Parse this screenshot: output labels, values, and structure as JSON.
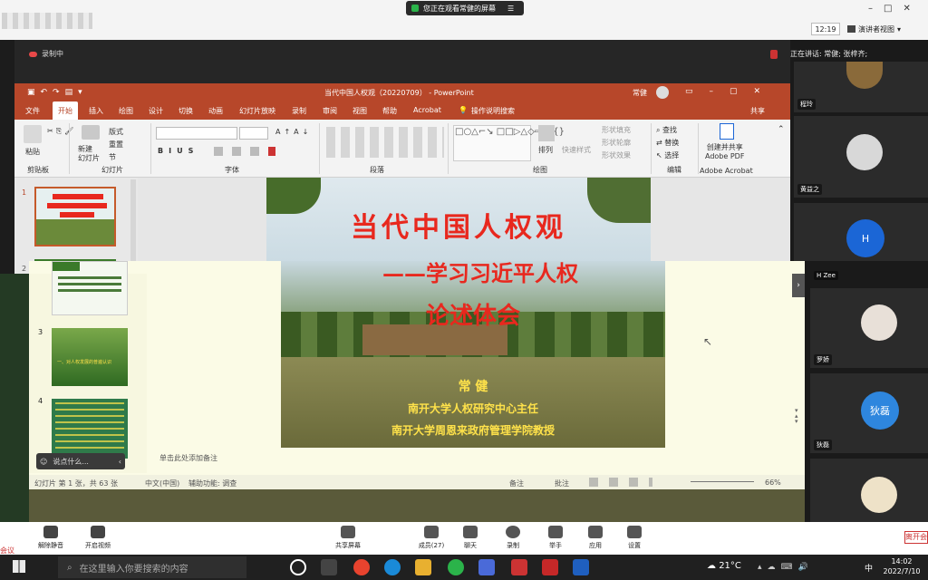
{
  "screen_share_banner": "您正在观看常健的屏幕",
  "clock": "12:19",
  "view_mode": "演讲者视图",
  "recording_label": "录制中",
  "speaking_text": "正在讲话: 常健; 张梓齐;",
  "participants_upper": [
    {
      "name": "程玲"
    },
    {
      "name": "黄益之"
    },
    {
      "name": "",
      "initial": "H"
    }
  ],
  "participants_lower": [
    {
      "name": "H Zee"
    },
    {
      "name": "罗娇"
    },
    {
      "name": "狄磊",
      "initial": "狄磊"
    },
    {
      "name": ""
    }
  ],
  "ppt": {
    "title": "当代中国人权观（20220709） - PowerPoint",
    "user": "常健",
    "tabs": [
      "文件",
      "开始",
      "插入",
      "绘图",
      "设计",
      "切换",
      "动画",
      "幻灯片放映",
      "录制",
      "审阅",
      "视图",
      "帮助",
      "Acrobat"
    ],
    "tell_me": "操作说明搜索",
    "share": "共享",
    "groups": {
      "clipboard": "剪贴板",
      "slides": "幻灯片",
      "font": "字体",
      "paragraph": "段落",
      "drawing": "绘图",
      "editing": "编辑",
      "acrobat": "Adobe Acrobat"
    },
    "buttons": {
      "paste": "粘贴",
      "new_slide": "新建\n幻灯片",
      "layout": "版式",
      "reset": "重置",
      "section": "节",
      "arrange": "排列",
      "quick_styles": "快速样式",
      "shape_fill": "形状填充",
      "shape_outline": "形状轮廓",
      "shape_effects": "形状效果",
      "find": "查找",
      "replace": "替换",
      "select": "选择",
      "create_pdf": "创建并共享\nAdobe PDF"
    },
    "font_style_buttons": [
      "B",
      "I",
      "U",
      "S"
    ],
    "slide_numbers": [
      "1",
      "2",
      "3",
      "4"
    ],
    "thumb2_text": "一、对人权发展的普遍认识",
    "thumb3_text": "一、对人权发展的普遍认识",
    "slide": {
      "title_line1": "当代中国人权观",
      "title_line2": "——学习习近平人权",
      "title_line3": "论述体会",
      "author": "常 健",
      "affiliation1": "南开大学人权研究中心主任",
      "affiliation2": "南开大学周恩来政府管理学院教授"
    },
    "notes_placeholder": "单击此处添加备注",
    "chat_bubble": "说点什么...",
    "status": {
      "slide_count": "幻灯片 第 1 张，共 63 张",
      "language": "中文(中国)",
      "accessibility": "辅助功能: 调查",
      "notes": "备注",
      "comments": "批注",
      "zoom": "66%"
    }
  },
  "meeting_bar": [
    {
      "label": "解除静音"
    },
    {
      "label": "开启视频"
    },
    {
      "label": "共享屏幕"
    },
    {
      "label": "成员(27)"
    },
    {
      "label": "聊天"
    },
    {
      "label": "录制"
    },
    {
      "label": "举手"
    },
    {
      "label": "应用"
    },
    {
      "label": "设置"
    }
  ],
  "meeting_left": "会议",
  "meeting_right": "离开会",
  "taskbar": {
    "search_placeholder": "在这里输入你要搜索的内容",
    "weather": "21°C",
    "time": "14:02",
    "date": "2022/7/10",
    "ime": "中"
  },
  "colors": {
    "ppt_red": "#b7472a",
    "slide_title_red": "#e8281e",
    "slide_text_yellow": "#ffe24a"
  }
}
